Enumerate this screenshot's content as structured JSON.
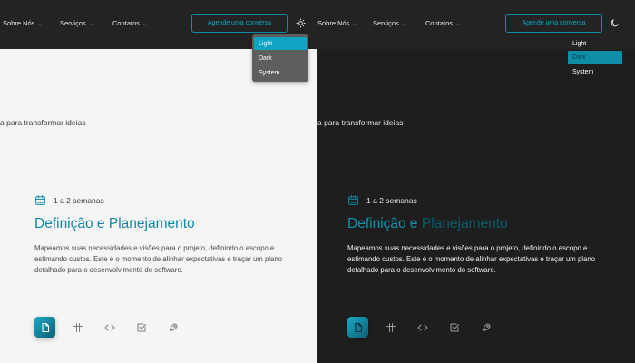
{
  "nav": {
    "items": [
      {
        "label": "Sobre Nós"
      },
      {
        "label": "Serviços"
      },
      {
        "label": "Contatos"
      }
    ],
    "cta_label": "Agende uma conversa"
  },
  "theme_menu": {
    "options": [
      "Light",
      "Dark",
      "System"
    ]
  },
  "light_panel": {
    "selected_theme": "Light",
    "theme_icon": "sun-icon"
  },
  "dark_panel": {
    "selected_theme": "Dark",
    "theme_icon": "moon-icon"
  },
  "hero": {
    "tagline": "a para transformar ideias"
  },
  "phase": {
    "duration": "1 a 2 semanas",
    "title_part1": "Definição e ",
    "title_part2": "Planejamento",
    "description": "Mapeamos suas necessidades e visões para o projeto, definindo o escopo e estimando custos. Este é o momento de alinhar expectativas e traçar um plano detalhado para o desenvolvimento do software."
  },
  "steps": [
    {
      "icon": "document-icon",
      "active": true
    },
    {
      "icon": "hash-icon",
      "active": false
    },
    {
      "icon": "code-icon",
      "active": false
    },
    {
      "icon": "checkbox-icon",
      "active": false
    },
    {
      "icon": "rocket-icon",
      "active": false
    }
  ],
  "colors": {
    "accent": "#0f87a3",
    "nav_bg": "#232323",
    "light_bg": "#f5f5f5",
    "dark_bg": "#1e1e1e"
  }
}
